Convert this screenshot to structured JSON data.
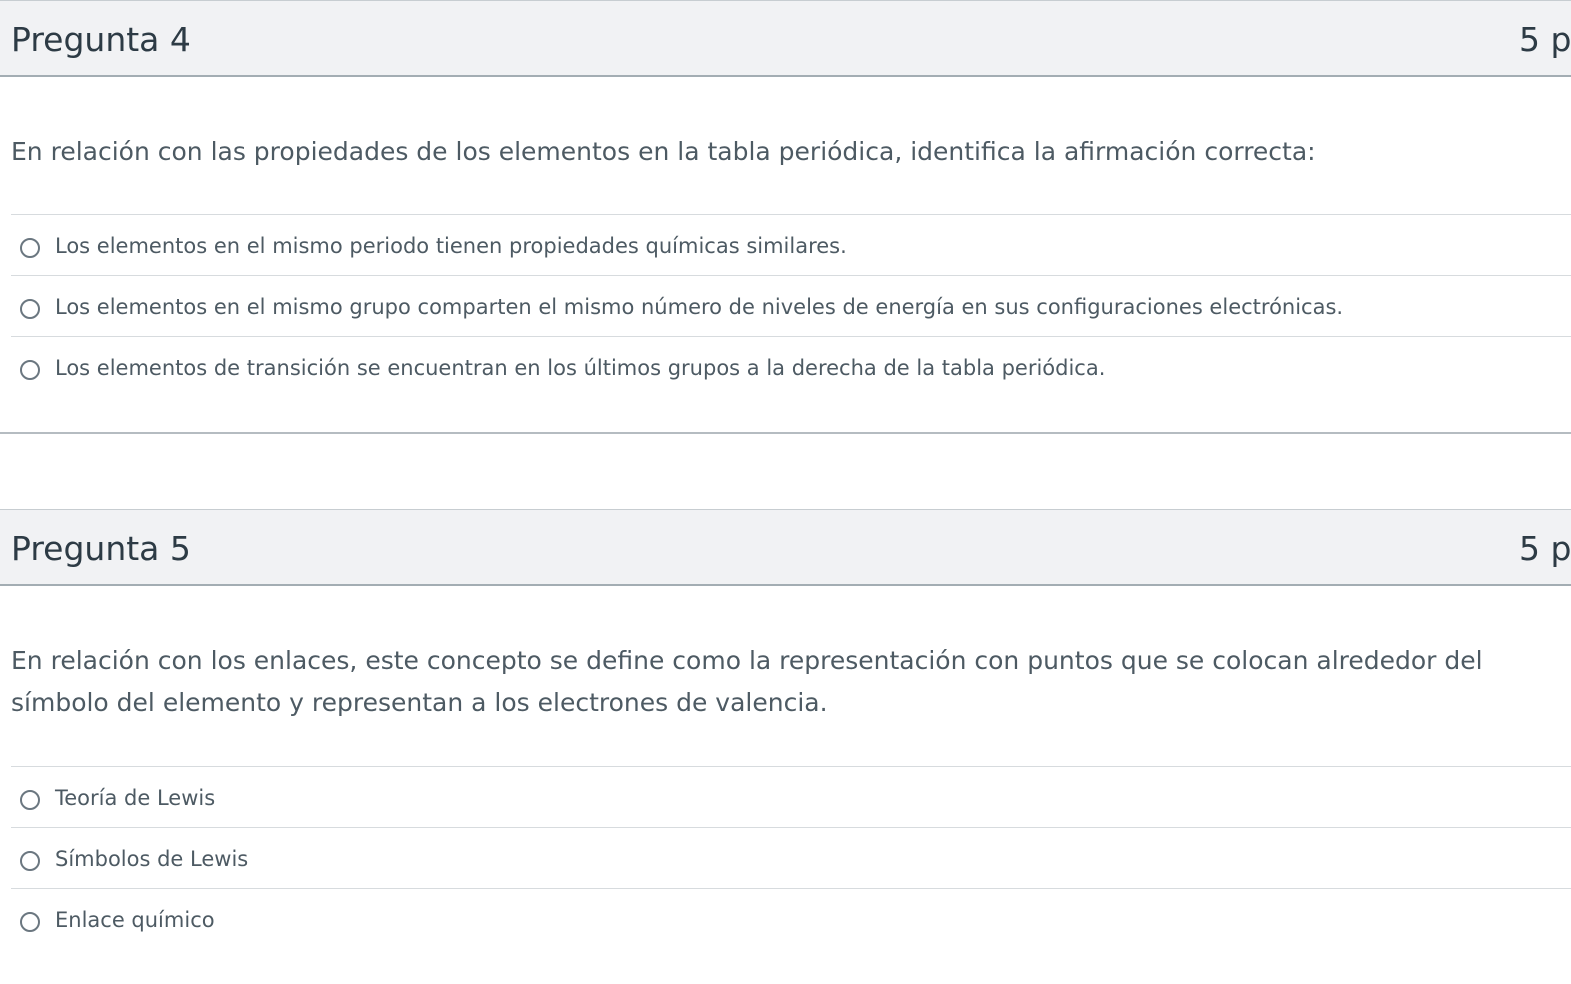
{
  "questions": [
    {
      "title": "Pregunta 4",
      "points": "5 p",
      "text": "En relación con las propiedades de los elementos en la tabla periódica, identifica la afirmación correcta:",
      "answers": [
        "Los elementos en el mismo periodo tienen propiedades químicas similares.",
        "Los elementos en el mismo grupo comparten el mismo número de niveles de energía en sus configuraciones electrónicas.",
        "Los elementos de transición se encuentran en los últimos grupos a la derecha de la tabla periódica."
      ]
    },
    {
      "title": "Pregunta 5",
      "points": "5 p",
      "text": "En relación con los enlaces, este concepto se define como la representación con puntos que se colocan alrededor del símbolo del elemento y representan a los electrones de valencia.",
      "answers": [
        "Teoría de Lewis",
        "Símbolos de Lewis",
        "Enlace químico"
      ]
    }
  ]
}
